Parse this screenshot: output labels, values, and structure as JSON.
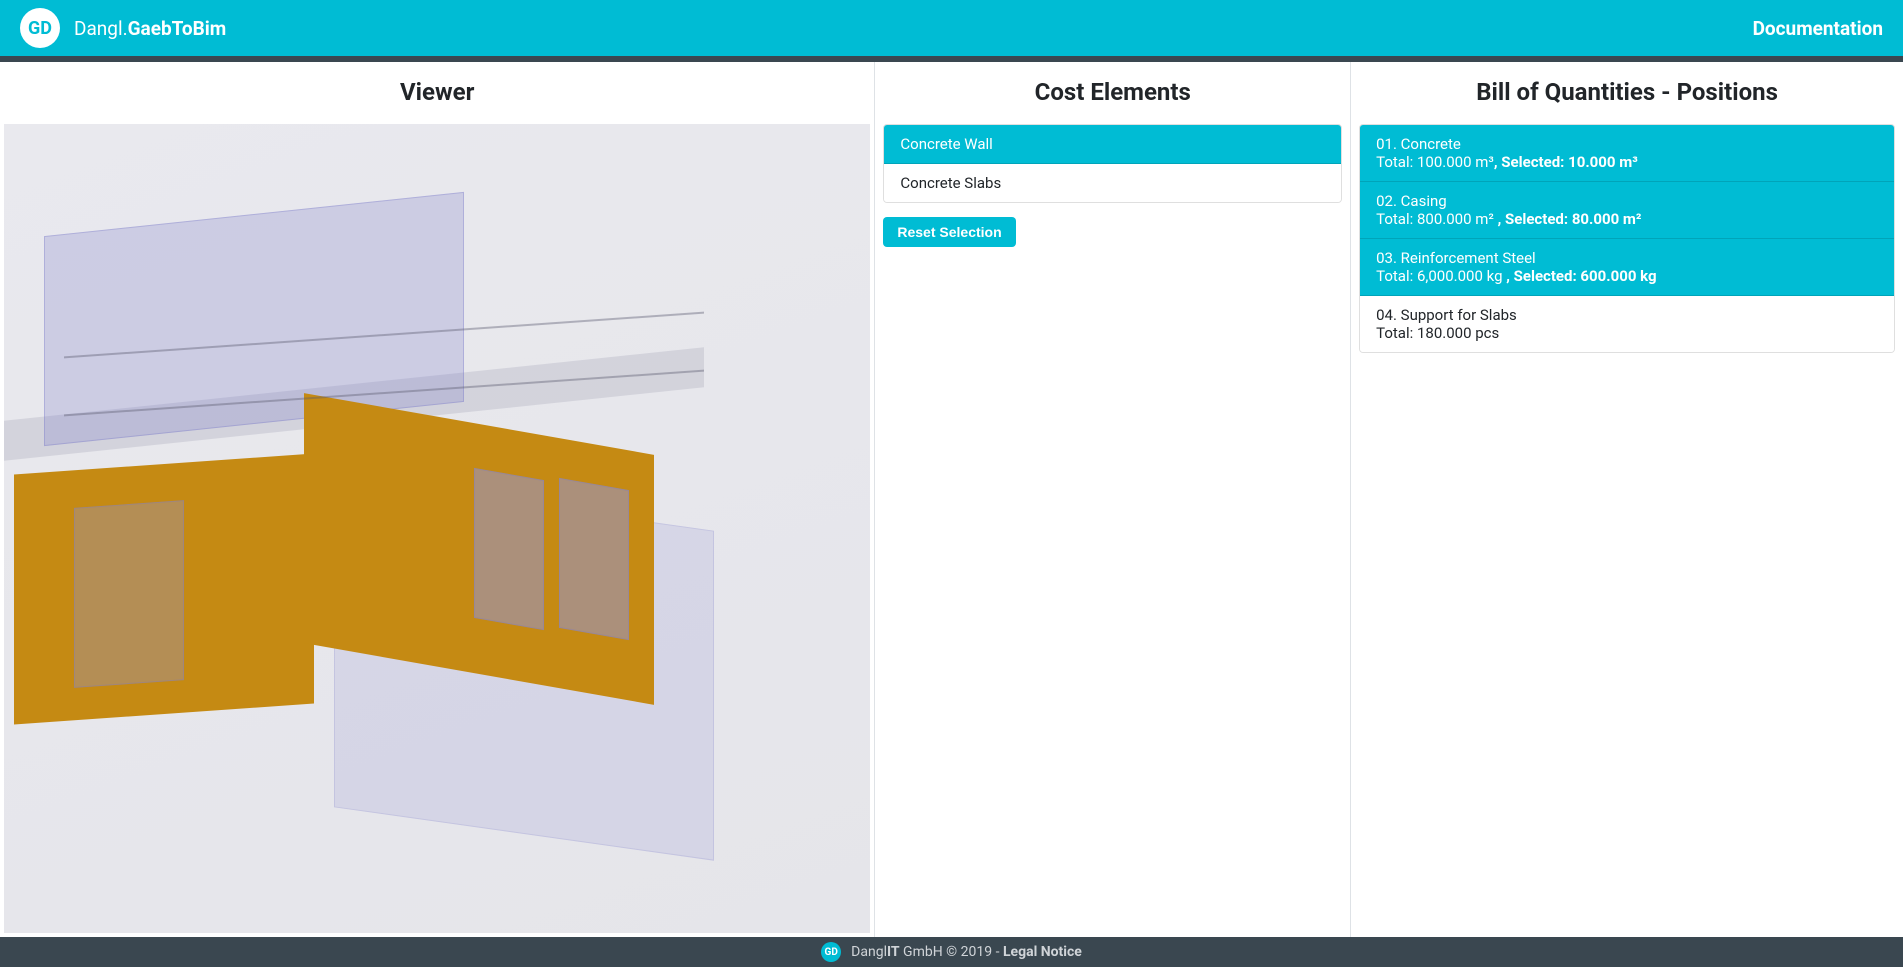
{
  "navbar": {
    "logo_text": "GD",
    "title_light": "Dangl.",
    "title_bold": "GaebToBim",
    "documentation": "Documentation"
  },
  "viewer": {
    "title": "Viewer"
  },
  "cost": {
    "title": "Cost Elements",
    "items": [
      {
        "label": "Concrete Wall",
        "active": true
      },
      {
        "label": "Concrete Slabs",
        "active": false
      }
    ],
    "reset_label": "Reset Selection"
  },
  "boq": {
    "title": "Bill of Quantities - Positions",
    "items": [
      {
        "line1": "01. Concrete",
        "total": "Total: 100.000 m³",
        "selected": ", Selected: 10.000 m³",
        "active": true
      },
      {
        "line1": "02. Casing",
        "total": "Total: 800.000 m² ",
        "selected": ", Selected: 80.000 m²",
        "active": true
      },
      {
        "line1": "03. Reinforcement Steel",
        "total": "Total: 6,000.000 kg ",
        "selected": ", Selected: 600.000 kg",
        "active": true
      },
      {
        "line1": "04. Support for Slabs",
        "total": "Total: 180.000 pcs",
        "selected": "",
        "active": false
      }
    ]
  },
  "footer": {
    "logo_text": "GD",
    "company_prefix": "Dangl",
    "company_bold": "IT",
    "copyright": " GmbH © 2019 - ",
    "legal": "Legal Notice"
  }
}
